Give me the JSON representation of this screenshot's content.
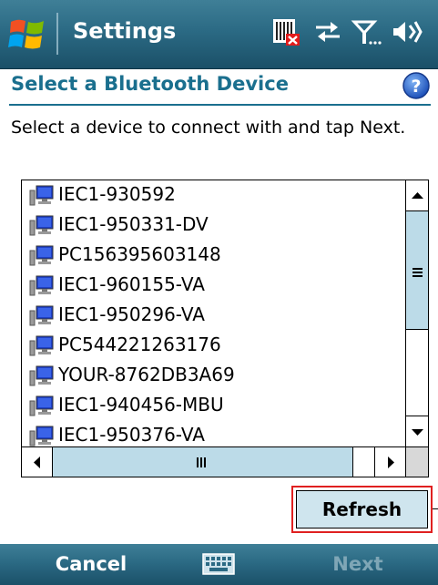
{
  "titlebar": {
    "app_title": "Settings",
    "icons": [
      "windows-start-icon",
      "sim-card-missing-icon",
      "connectivity-icon",
      "signal-strength-icon",
      "volume-icon"
    ]
  },
  "header": {
    "title": "Select a Bluetooth Device",
    "help_icon": "help-icon"
  },
  "instructions": "Select a device to connect with and tap Next.",
  "device_list": {
    "items": [
      {
        "label": "IEC1-930592",
        "icon": "computer-icon"
      },
      {
        "label": "IEC1-950331-DV",
        "icon": "computer-icon"
      },
      {
        "label": "PC156395603148",
        "icon": "computer-icon"
      },
      {
        "label": "IEC1-960155-VA",
        "icon": "computer-icon"
      },
      {
        "label": "IEC1-950296-VA",
        "icon": "computer-icon"
      },
      {
        "label": "PC544221263176",
        "icon": "computer-icon"
      },
      {
        "label": "YOUR-8762DB3A69",
        "icon": "computer-icon"
      },
      {
        "label": "IEC1-940456-MBU",
        "icon": "computer-icon"
      },
      {
        "label": "IEC1-950376-VA",
        "icon": "computer-icon"
      }
    ]
  },
  "refresh_label": "Refresh",
  "menubar": {
    "left_softkey": "Cancel",
    "right_softkey": "Next",
    "center_icon": "keyboard-icon"
  },
  "colors": {
    "bar_gradient_top": "#3f7f97",
    "bar_gradient_bottom": "#1b5068",
    "header_text": "#1a6f8e",
    "selection_highlight": "#e02020",
    "scroll_thumb": "#bcdbe8",
    "disabled_softkey": "#7fa6b6"
  }
}
